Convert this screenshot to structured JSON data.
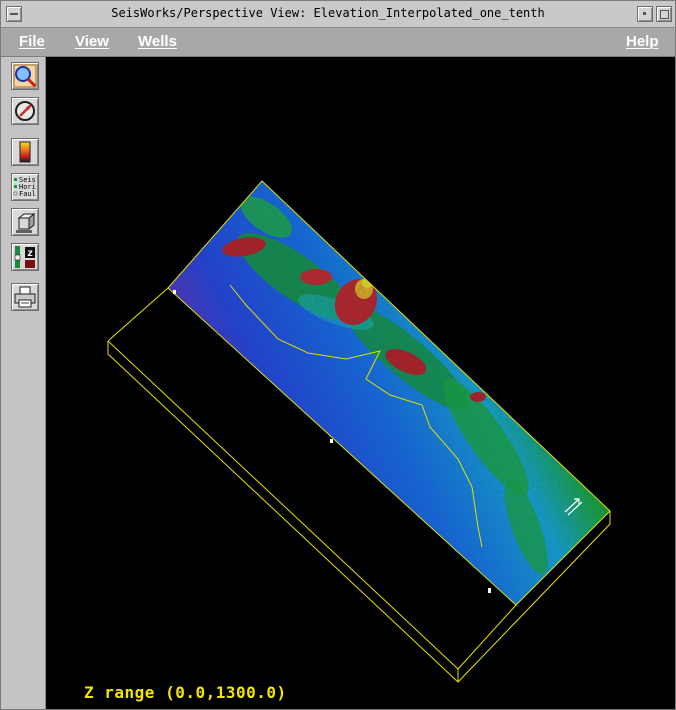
{
  "window": {
    "title": "SeisWorks/Perspective View: Elevation_Interpolated_one_tenth"
  },
  "menubar": {
    "file": "File",
    "view": "View",
    "wells": "Wells",
    "help": "Help"
  },
  "toolbar": {
    "tools": [
      {
        "name": "zoom-tool",
        "icon": "magnifier-icon"
      },
      {
        "name": "rotate-tool",
        "icon": "compass-icon"
      },
      {
        "name": "colorbar-tool",
        "icon": "colorbar-icon"
      },
      {
        "name": "display-toggle-tool",
        "icon": "seis-hori-faul-icon",
        "labels": [
          "Seis",
          "Hori",
          "Faul"
        ]
      },
      {
        "name": "cube-tool",
        "icon": "cube-icon"
      },
      {
        "name": "z-scale-tool",
        "icon": "z-slider-icon",
        "letter": "z"
      },
      {
        "name": "print-tool",
        "icon": "printer-icon"
      }
    ]
  },
  "viewport": {
    "z_range_text": "Z range (0.0,1300.0)",
    "colors": {
      "bounding_box": "#e8e000",
      "background": "#000000",
      "fault_line": "#e0e000"
    },
    "colormap": [
      "#6a1fb8",
      "#2a35e0",
      "#1a70e8",
      "#20b0d0",
      "#1e9a3a",
      "#0f6a22",
      "#c01020",
      "#e02030",
      "#f0a020",
      "#f5e020"
    ]
  }
}
